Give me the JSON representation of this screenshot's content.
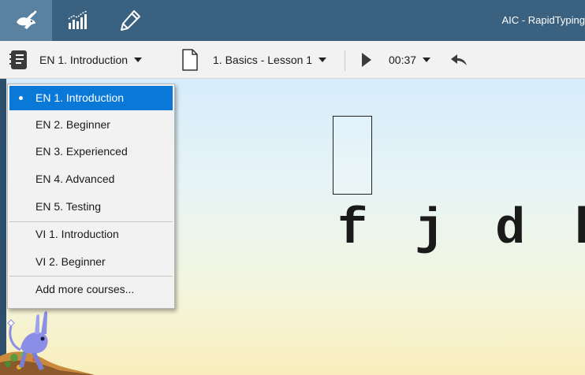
{
  "titlebar": {
    "app_title": "AIC - RapidTyping",
    "buttons": [
      {
        "icon": "rabbit-icon",
        "active": true
      },
      {
        "icon": "statistics-icon",
        "active": false
      },
      {
        "icon": "editor-pen-icon",
        "active": false
      }
    ]
  },
  "toolbar": {
    "course_label": "EN 1. Introduction",
    "lesson_label": "1. Basics - Lesson 1",
    "timer_label": "00:37",
    "icons": [
      "course-book-icon",
      "lesson-page-icon",
      "play-icon",
      "undo-icon"
    ]
  },
  "course_menu": {
    "items": [
      {
        "label": "EN 1. Introduction",
        "selected": true
      },
      {
        "label": "EN 2. Beginner",
        "selected": false
      },
      {
        "label": "EN 3. Experienced",
        "selected": false
      },
      {
        "label": "EN 4. Advanced",
        "selected": false
      },
      {
        "label": "EN 5. Testing",
        "selected": false
      },
      {
        "label": "VI 1. Introduction",
        "selected": false
      },
      {
        "label": "VI 2. Beginner",
        "selected": false
      },
      {
        "label": "Add more courses...",
        "selected": false
      }
    ]
  },
  "lesson": {
    "letters": [
      "f",
      "j",
      "d",
      "k"
    ],
    "current_letter": "f"
  },
  "colors": {
    "titlebar": "#3a6280",
    "titlebar_active": "#5b81a0",
    "selection": "#0a78d7",
    "toolbar": "#f2f2f2"
  }
}
